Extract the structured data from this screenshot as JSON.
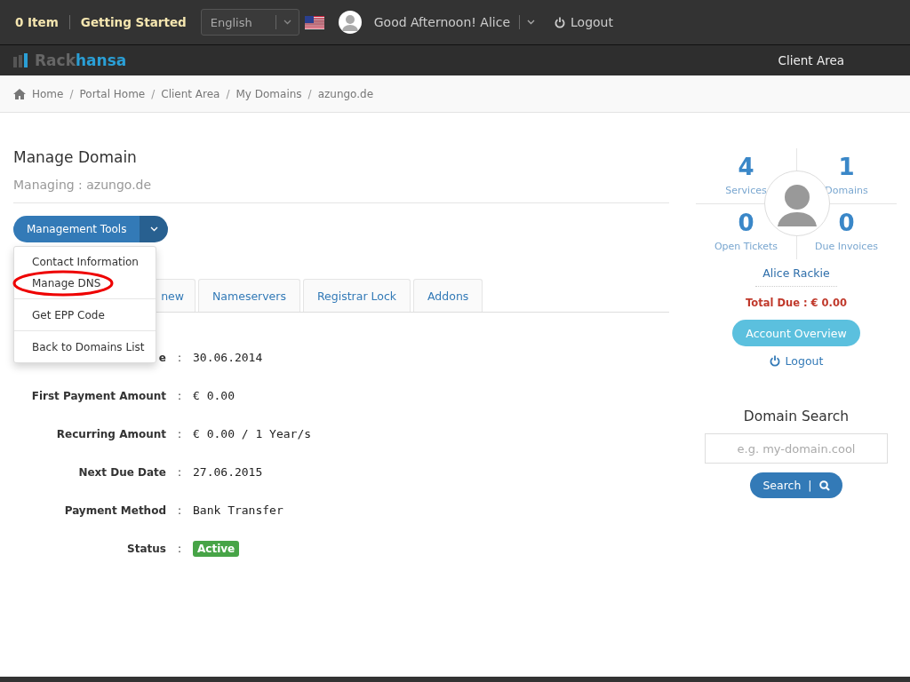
{
  "topbar": {
    "cart": "0 Item",
    "getting_started": "Getting Started",
    "language": {
      "value": "English"
    },
    "greeting": "Good Afternoon! Alice",
    "logout": "Logout"
  },
  "navbar": {
    "logo_a": "Rack",
    "logo_b": "hansa",
    "link": "Client Area"
  },
  "breadcrumb": {
    "separator": "/",
    "items": [
      "Home",
      "Portal Home",
      "Client Area",
      "My Domains",
      "azungo.de"
    ]
  },
  "page": {
    "title": "Manage Domain",
    "subtitle": "Managing : azungo.de"
  },
  "tools_button": "Management Tools",
  "menu": {
    "open": true,
    "items": [
      {
        "label": "Contact Information",
        "highlighted": false
      },
      {
        "label": "Manage DNS",
        "highlighted": true
      },
      {
        "label": "Get EPP Code",
        "highlighted": false
      },
      {
        "label": "Back to Domains List",
        "highlighted": false
      }
    ]
  },
  "tabs": [
    {
      "label": "new",
      "selected": false
    },
    {
      "label": "Nameservers",
      "selected": false
    },
    {
      "label": "Registrar Lock",
      "selected": false
    },
    {
      "label": "Addons",
      "selected": false
    }
  ],
  "details": [
    {
      "label": "e",
      "colon": ":",
      "value": "30.06.2014",
      "kind": "text"
    },
    {
      "label": "First Payment Amount",
      "colon": ":",
      "value": "€ 0.00",
      "kind": "text"
    },
    {
      "label": "Recurring Amount",
      "colon": ":",
      "value": "€ 0.00 / 1 Year/s",
      "kind": "text"
    },
    {
      "label": "Next Due Date",
      "colon": ":",
      "value": "27.06.2015",
      "kind": "text"
    },
    {
      "label": "Payment Method",
      "colon": ":",
      "value": "Bank Transfer",
      "kind": "text"
    },
    {
      "label": "Status",
      "colon": ":",
      "value": "Active",
      "kind": "badge"
    }
  ],
  "sidebar": {
    "stats": [
      {
        "count": "4",
        "label": "Services"
      },
      {
        "count": "1",
        "label": "Domains"
      },
      {
        "count": "0",
        "label": "Open Tickets"
      },
      {
        "count": "0",
        "label": "Due Invoices"
      }
    ],
    "name": "Alice Rackie",
    "total_due": "Total Due : € 0.00",
    "overview_button": "Account Overview",
    "logout": "Logout"
  },
  "domain_search": {
    "title": "Domain Search",
    "placeholder": "e.g. my-domain.cool",
    "button": "Search",
    "separator": "|"
  }
}
